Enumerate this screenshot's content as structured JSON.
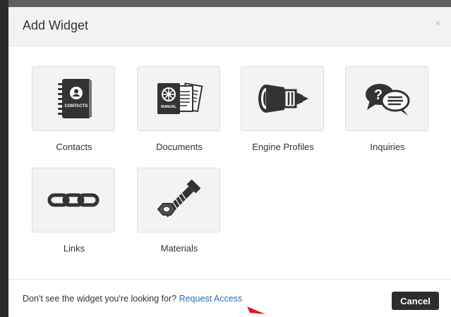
{
  "modal": {
    "title": "Add Widget",
    "close_glyph": "×"
  },
  "widgets": [
    {
      "label": "Contacts",
      "icon": "contacts-book-icon",
      "badge": "CONTACTS"
    },
    {
      "label": "Documents",
      "icon": "documents-manual-icon",
      "badge": "MANUAL"
    },
    {
      "label": "Engine Profiles",
      "icon": "jet-engine-icon"
    },
    {
      "label": "Inquiries",
      "icon": "question-speech-bubbles-icon"
    },
    {
      "label": "Links",
      "icon": "chain-link-icon"
    },
    {
      "label": "Materials",
      "icon": "bolt-nut-icon"
    }
  ],
  "footer": {
    "prompt": "Don't see the widget you're looking for? ",
    "request_link": "Request Access",
    "cancel_label": "Cancel"
  },
  "colors": {
    "link": "#2a6fb5",
    "icon": "#333333",
    "cursor": "#e8141e"
  }
}
